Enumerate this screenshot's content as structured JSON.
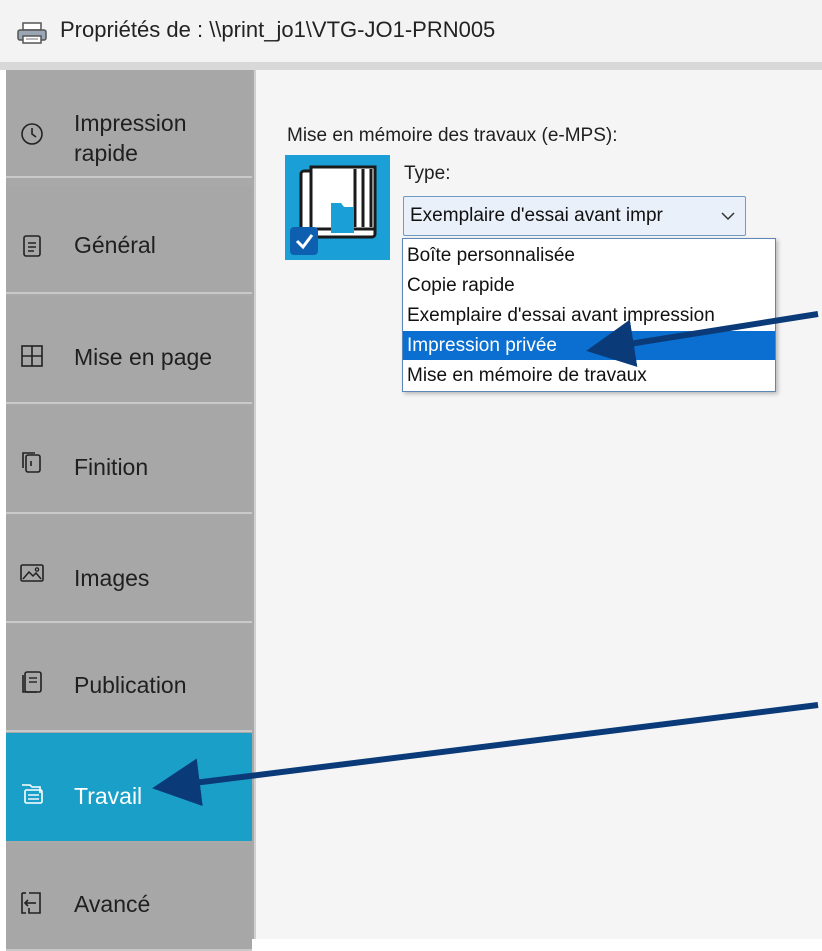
{
  "window": {
    "title": "Propriétés de : \\\\print_jo1\\VTG-JO1-PRN005",
    "title_icon": "printer-icon"
  },
  "sidebar": {
    "items": [
      {
        "label": "Impression\nrapide",
        "icon": "clock-icon",
        "active": false
      },
      {
        "label": "Général",
        "icon": "document-icon",
        "active": false
      },
      {
        "label": "Mise en page",
        "icon": "grid-icon",
        "active": false
      },
      {
        "label": "Finition",
        "icon": "staple-icon",
        "active": false
      },
      {
        "label": "Images",
        "icon": "image-icon",
        "active": false
      },
      {
        "label": "Publication",
        "icon": "publication-icon",
        "active": false
      },
      {
        "label": "Travail",
        "icon": "job-icon",
        "active": true
      },
      {
        "label": "Avancé",
        "icon": "export-icon",
        "active": false
      }
    ],
    "active_color": "#1aa0c8"
  },
  "job_panel": {
    "section_label": "Mise en mémoire des travaux (e-MPS):",
    "type_label": "Type:",
    "type_select": {
      "value": "Exemplaire d'essai avant impr",
      "options": [
        "Boîte personnalisée",
        "Copie rapide",
        "Exemplaire d'essai avant impression",
        "Impression privée",
        "Mise en mémoire de travaux"
      ],
      "highlighted_option": "Impression privée"
    }
  },
  "annotations": {
    "arrow_color": "#0b3a78"
  }
}
